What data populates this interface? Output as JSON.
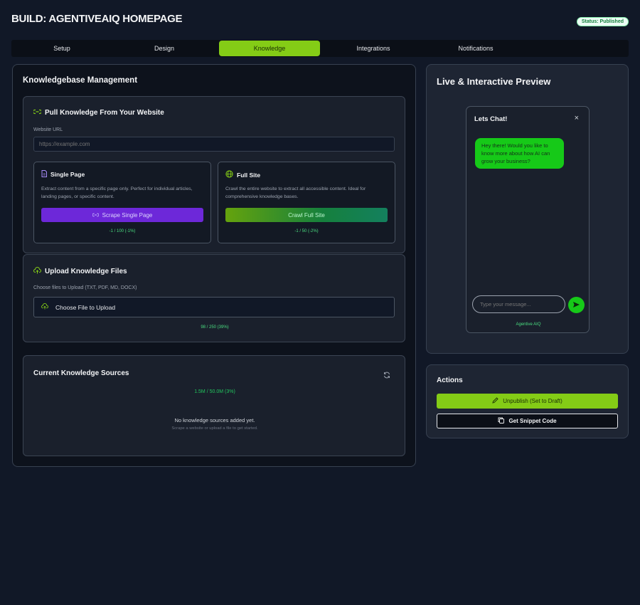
{
  "header": {
    "title": "BUILD: AGENTIVEAIQ HOMEPAGE",
    "status": "Status: Published"
  },
  "tabs": [
    {
      "label": "Setup"
    },
    {
      "label": "Design"
    },
    {
      "label": "Knowledge"
    },
    {
      "label": "Integrations"
    },
    {
      "label": "Notifications"
    }
  ],
  "active_tab": "Knowledge",
  "knowledge": {
    "title": "Knowledgebase Management",
    "pull": {
      "title": "Pull Knowledge From Your Website",
      "url_label": "Website URL",
      "url_placeholder": "https://example.com",
      "single": {
        "title": "Single Page",
        "desc": "Extract content from a specific page only. Perfect for individual articles, landing pages, or specific content.",
        "button": "Scrape Single Page",
        "usage": "-1 / 100 (-1%)"
      },
      "full": {
        "title": "Full Site",
        "desc": "Crawl the entire website to extract all accessible content. Ideal for comprehensive knowledge bases.",
        "button": "Crawl Full Site",
        "usage": "-1 / 50 (-2%)"
      }
    },
    "upload": {
      "title": "Upload Knowledge Files",
      "label": "Choose files to Upload (TXT, PDF, MD, DOCX)",
      "button": "Choose File to Upload",
      "usage": "98 / 250 (39%)"
    },
    "sources": {
      "title": "Current Knowledge Sources",
      "storage": "1.5M / 50.0M (3%)",
      "empty_title": "No knowledge sources added yet.",
      "empty_hint": "Scrape a website or upload a file to get started."
    }
  },
  "preview": {
    "title": "Live & Interactive Preview",
    "chat": {
      "header": "Lets Chat!",
      "close": "×",
      "message": "Hey there! Would you like to know more about how AI can grow your business?",
      "input_placeholder": "Type your message...",
      "footer": "Agentive AIQ"
    }
  },
  "actions": {
    "title": "Actions",
    "unpublish": "Unpublish (Set to Draft)",
    "snippet": "Get Snippet Code"
  },
  "colors": {
    "accent": "#84cc16",
    "purple": "#6d28d9",
    "chat_green": "#16c918"
  }
}
